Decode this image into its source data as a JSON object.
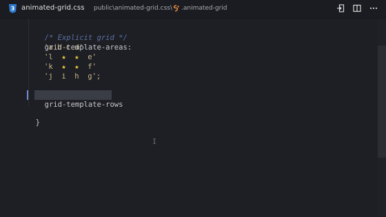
{
  "titlebar": {
    "filename": "animated-grid.css",
    "breadcrumb_path": "public\\animated-grid.css\\",
    "breadcrumb_symbol": ".animated-grid",
    "icons": [
      "css-file-icon",
      "css-selector-icon",
      "open-preview-icon",
      "split-editor-icon",
      "more-actions-icon"
    ]
  },
  "editor": {
    "comment": "/* Explicit grid */",
    "property": "grid-template-areas:",
    "rows": [
      {
        "q1": "'",
        "a": "a",
        "b": "b",
        "c": "c",
        "d": "d",
        "q2": "'"
      },
      {
        "q1": "'",
        "a": "l",
        "b": "★",
        "c": "★",
        "d": "e",
        "q2": "'"
      },
      {
        "q1": "'",
        "a": "k",
        "b": "★",
        "c": "★",
        "d": "f",
        "q2": "'"
      },
      {
        "q1": "'",
        "a": "j",
        "b": "i",
        "c": "h",
        "d": "g",
        "q2": "';"
      }
    ],
    "typed_text": "grid-template-rows",
    "closing_brace": "}"
  },
  "colors": {
    "background": "#1e1f24",
    "comment": "#5a6fa3",
    "string": "#c9b98b",
    "star": "#f2d23c",
    "text": "#c5c8cf"
  }
}
